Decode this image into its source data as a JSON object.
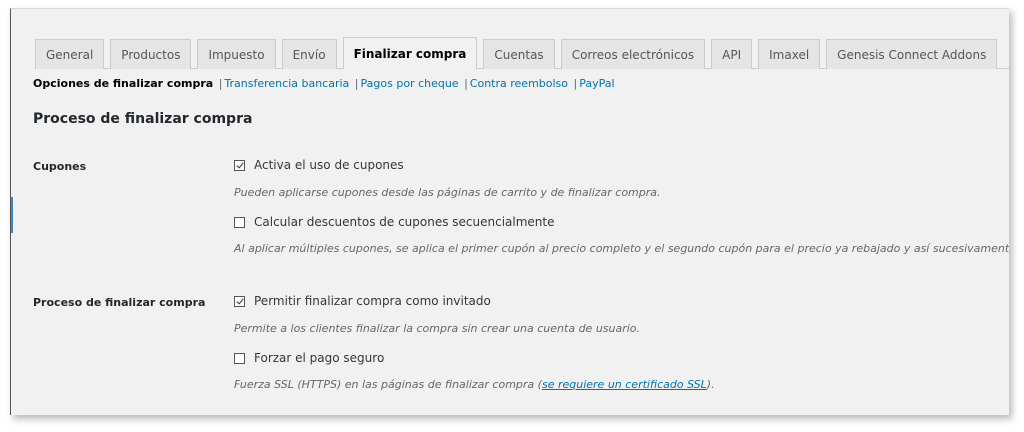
{
  "tabs": [
    {
      "label": "General",
      "active": false
    },
    {
      "label": "Productos",
      "active": false
    },
    {
      "label": "Impuesto",
      "active": false
    },
    {
      "label": "Envío",
      "active": false
    },
    {
      "label": "Finalizar compra",
      "active": true
    },
    {
      "label": "Cuentas",
      "active": false
    },
    {
      "label": "Correos electrónicos",
      "active": false
    },
    {
      "label": "API",
      "active": false
    },
    {
      "label": "Imaxel",
      "active": false
    },
    {
      "label": "Genesis Connect Addons",
      "active": false
    }
  ],
  "subnav": {
    "current": "Opciones de finalizar compra",
    "separator": "|",
    "links": [
      "Transferencia bancaria",
      "Pagos por cheque",
      "Contra reembolso",
      "PayPal"
    ]
  },
  "section_title": "Proceso de finalizar compra",
  "coupons": {
    "label": "Cupones",
    "enable": {
      "label": "Activa el uso de cupones",
      "checked": true,
      "description": "Pueden aplicarse cupones desde las páginas de carrito y de finalizar compra."
    },
    "sequential": {
      "label": "Calcular descuentos de cupones secuencialmente",
      "checked": false,
      "description": "Al aplicar múltiples cupones, se aplica el primer cupón al precio completo y el segundo cupón para el precio ya rebajado y así sucesivamente."
    }
  },
  "checkout_process": {
    "label": "Proceso de finalizar compra",
    "guest": {
      "label": "Permitir finalizar compra como invitado",
      "checked": true,
      "description": "Permite a los clientes finalizar la compra sin crear una cuenta de usuario."
    },
    "secure": {
      "label": "Forzar el pago seguro",
      "checked": false,
      "description_prefix": "Fuerza SSL (HTTPS) en las páginas de finalizar compra (",
      "description_link": "se requiere un certificado SSL",
      "description_suffix": ")."
    }
  },
  "colors": {
    "link": "#0073aa",
    "background": "#f1f1f1",
    "tab_inactive": "#e5e5e5"
  }
}
